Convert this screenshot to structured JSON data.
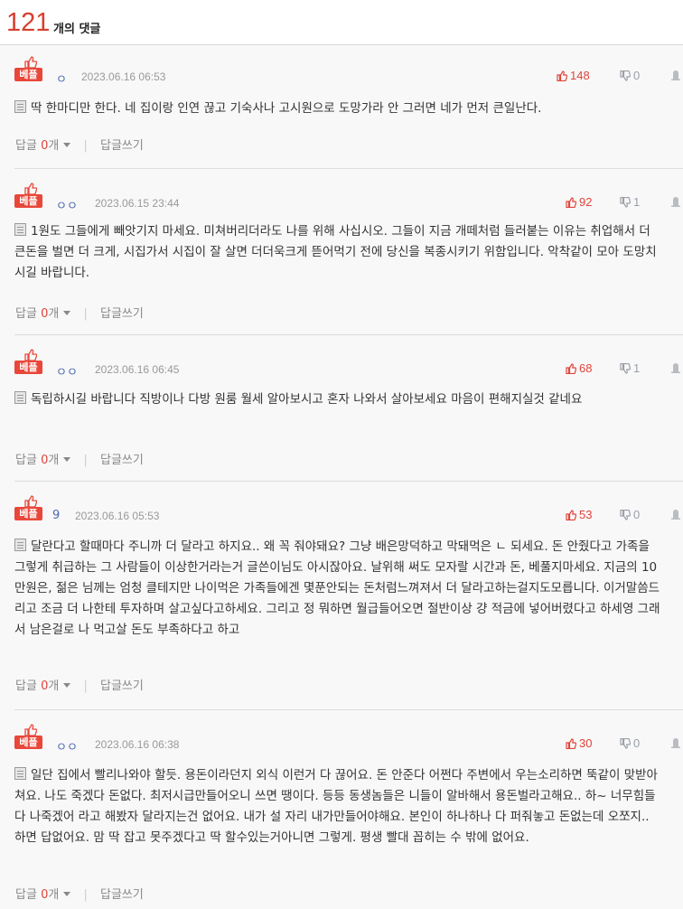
{
  "header": {
    "count": "121",
    "count_label": "개의 댓글"
  },
  "best_label": "베플",
  "reply_label": "답글",
  "reply_suffix": "개",
  "write_reply_label": "답글쓰기",
  "comments": [
    {
      "author": "ㅇ",
      "date": "2023.06.16 06:53",
      "up": "148",
      "down": "0",
      "text": "딱 한마디만 한다. 네 집이랑 인연 끊고 기숙사나 고시원으로 도망가라 안 그러면 네가 먼저 큰일난다.",
      "replies": "0"
    },
    {
      "author": "ㅇㅇ",
      "date": "2023.06.15 23:44",
      "up": "92",
      "down": "1",
      "text": "1원도 그들에게 빼앗기지 마세요. 미쳐버리더라도 나를 위해 사십시오. 그들이 지금 개떼처럼 들러붙는 이유는 취업해서 더 큰돈을 벌면 더 크게, 시집가서 시집이 잘 살면 더더욱크게 뜯어먹기 전에 당신을 복종시키기 위함입니다. 악착같이 모아 도망치시길 바랍니다.",
      "replies": "0"
    },
    {
      "author": "ㅇㅇ",
      "date": "2023.06.16 06:45",
      "up": "68",
      "down": "1",
      "text": "독립하시길 바랍니다 직방이나 다방 원룸 월세 알아보시고 혼자 나와서 살아보세요 마음이 편해지실것 같네요",
      "replies": "0"
    },
    {
      "author": "9",
      "date": "2023.06.16 05:53",
      "up": "53",
      "down": "0",
      "text": "달란다고 할때마다 주니까 더 달라고 하지요.. 왜 꼭 줘야돼요? 그냥 배은망덕하고 막돼먹은 ㄴ 되세요. 돈 안줬다고 가족을 그렇게 취급하는 그 사람들이 이상한거라는거 글쓴이님도 아시잖아요. 날위해 써도 모자랄 시간과 돈, 베풀지마세요. 지금의 10만원은, 젊은 님께는 엄청 클테지만 나이먹은 가족들에겐 몇푼안되는 돈처럼느껴져서 더 달라고하는걸지도모릅니다. 이거말씀드리고 조금 더 나한테 투자하며 살고싶다고하세요. 그리고 정 뭐하면 월급들어오면 절반이상 걍 적금에 넣어버렸다고 하세영 그래서 남은걸로 나 먹고살 돈도 부족하다고 하고",
      "replies": "0"
    },
    {
      "author": "ㅇㅇ",
      "date": "2023.06.16 06:38",
      "up": "30",
      "down": "0",
      "text": "일단 집에서 빨리나와야 할듯. 용돈이라던지 외식 이런거 다 끊어요. 돈 안준다 어쩐다 주변에서 우는소리하면 뚝같이 맞받아쳐요. 나도 죽겠다 돈없다. 최저시급만들어오니 쓰면 땡이다. 등등 동생놈들은 니들이 알바해서 용돈벌라고해요.. 하~ 너무힘들다 나죽겠어 라고 해봤자 달라지는건 없어요. 내가 설 자리 내가만들어야해요. 본인이 하나하나 다 퍼줘놓고 돈없는데 오쪼지.. 하면 답없어요. 맘 딱 잡고 못주겠다고 딱 할수있는거아니면 그렇게. 평생 빨대 꼽히는 수 밖에 없어요.",
      "replies": "0"
    }
  ]
}
